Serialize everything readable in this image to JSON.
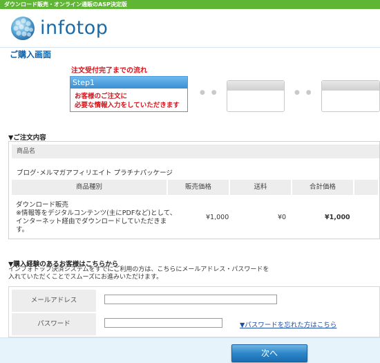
{
  "header": {
    "topbar_text": "ダウンロード販売・オンライン通販のASP決定版",
    "logo_text": "infotop"
  },
  "page_title": "ご購入画面",
  "flow": {
    "title": "注文受付完了までの流れ",
    "step1_label": "Step1",
    "step1_desc_line1": "お客様のご注文に",
    "step1_desc_line2": "必要な情報入力をしていただきます",
    "connector": "● ●"
  },
  "order": {
    "section_title": "▼ご注文内容",
    "product_header": "商品名",
    "product_name": "ブログ･メルマガアフィリエイト プラチナパッケージ",
    "columns": [
      "商品種別",
      "販売価格",
      "送料",
      "合計価格"
    ],
    "row": {
      "type_line1": "ダウンロード販売",
      "type_line2": "※情報等をデジタルコンテンツ(主にPDFなど)として、インターネット経由でダウンロードしていただきます。",
      "price": "¥1,000",
      "shipping": "¥0",
      "total": "¥1,000"
    }
  },
  "login": {
    "section_title": "▼購入経験のあるお客様はこちらから",
    "intro_line1": "インフォトップ決済システムをすでにご利用の方は、こちらにメールアドレス・パスワードを",
    "intro_line2": "入れていただくことでスムーズにお進みいただけます。",
    "email_label": "メールアドレス",
    "email_value": "",
    "password_label": "パスワード",
    "password_value": "",
    "forgot_link": "▼パスワードを忘れた方はこちら"
  },
  "footer": {
    "next_button": "次へ"
  },
  "colors": {
    "topbar": "#5fb534",
    "brand_blue": "#1b6aa8",
    "alert_red": "#d8141c"
  }
}
